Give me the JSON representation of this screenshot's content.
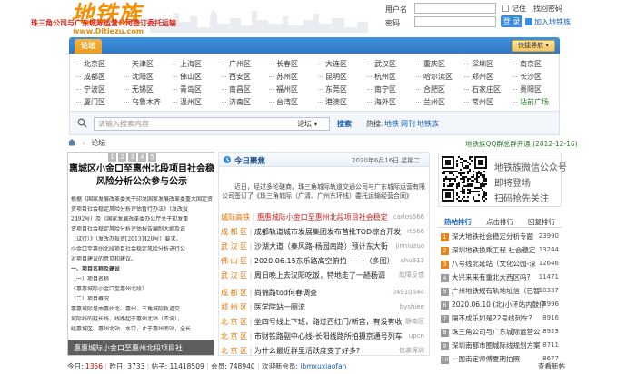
{
  "logo": {
    "title": "地铁族",
    "url": "www.Ditiezu.com"
  },
  "login": {
    "username_label": "用户名",
    "password_label": "密码",
    "remember_label": "记住",
    "forgot_label": "找回密码",
    "login_button": "登 录",
    "register_link": "加入地铁族"
  },
  "nav": {
    "forum_tab": "论坛",
    "quick_nav": "快捷导航"
  },
  "cities": [
    [
      "北京区",
      "天津区",
      "上海区",
      "广州区",
      "长春区",
      "大连区",
      "武汉区",
      "重庆区",
      "深圳区",
      "南京区"
    ],
    [
      "成都区",
      "沈阳区",
      "佛山区",
      "西安区",
      "苏州区",
      "昆明区",
      "杭州区",
      "哈尔滨区",
      "郑州区",
      "长沙区"
    ],
    [
      "宁波区",
      "无锡区",
      "青岛区",
      "南昌区",
      "福州区",
      "东莞区",
      "南宁区",
      "合肥区",
      "石家庄区",
      "贵阳区"
    ],
    [
      "厦门区",
      "乌鲁木齐",
      "温州区",
      "济南区",
      "台湾区",
      "港澳区",
      "海外区",
      "兰州区",
      "常州区",
      "站前广场"
    ]
  ],
  "city_colors": {
    "special": "#2c7a2c"
  },
  "search": {
    "placeholder": "请输入搜索内容",
    "scope": "论坛",
    "button": "搜索",
    "hot_label": "热搜:",
    "hot_terms": [
      "地铁",
      "网刊",
      "地铁族"
    ]
  },
  "breadcrumb": {
    "home_icon": "home-icon",
    "separator": "›",
    "current": "论坛"
  },
  "doc_preview": {
    "tabs": [
      "1",
      "2",
      "3",
      "4",
      "5"
    ],
    "title_lines": [
      "惠城区小金口至惠州北段项目社会稳",
      "风险分析公众参与公示"
    ],
    "body_lines": [
      "根据《国家发展改革委关于印发国家发展改革委重大固定资产",
      "资项目社会稳定风险分析评估暂行办法》（发改投",
      "2492号）及《国家发展改革委办公厅关于印发重",
      "资项目社会稳定风险分析评估报告编制大纲及说",
      "（试行）》（发改办投资[2013]428号）要求，",
      "小金口至惠州北段项目社会稳定风险分析进行公",
      "对项目建设的意见和建议。",
      "一、项目名称及建设",
      "（一）项目名称",
      "《惠惠城际小金口至惠州北段》",
      "（二）项目概况",
      "惠惠城际是由惠州北、惠州、三角城际轨道交",
      "城际线的延长线，线路起于惠州北站（不含），",
      "经惠城区、惠州北站、水口，止于惠州南站，全长"
    ],
    "caption": "惠惠城际小金口至惠州北段项目社"
  },
  "news": {
    "section_title": "今日聚焦",
    "date": "2020年6月16日 星期二",
    "headline": "珠三角公司与广东城际运营公司签订委托运输",
    "summary_lines": [
      "近日，经过多轮磋商，珠三角城际轨道交通公司与广东城际运营有限",
      "公司签订了《珠三角城际（广清、广州东环线）委托运输经营合同》及其"
    ],
    "items": [
      {
        "cat": "城际高铁",
        "title": "惠惠城际小金口至惠州北段项目社会稳定",
        "author": "carlos666",
        "red": true
      },
      {
        "cat": "成 都 区",
        "title": "成都轨道城市发展集团发布首批TOD综合开发",
        "author": "rt666",
        "red": false
      },
      {
        "cat": "武 汉 区",
        "title": "沙湖大道（秦风路-杨园南路）预计东大街",
        "author": "jinniuzuo",
        "red": false
      },
      {
        "cat": "佛 山 区",
        "title": "2020.06.15东乐路高空俯拍~~~（多图）",
        "author": "ahu813",
        "red": false
      },
      {
        "cat": "武 汉 区",
        "title": "周日晚上去汉阳吃饭，特地走了一趟杨泗",
        "author": "故障反馈",
        "red": false
      },
      {
        "cat": "成 都 区",
        "title": "尚锦路tod何春调查",
        "author": "04910644",
        "red": false
      },
      {
        "cat": "郑 州 区",
        "title": "医学院站一圈流",
        "author": "byshiee",
        "red": false
      },
      {
        "cat": "北 京 区",
        "title": "坐四号线上下班，路过西红门/新宫，有没有收",
        "author": "静南区",
        "red": false
      },
      {
        "cat": "北 京 区",
        "title": "市财铁路副中心线-长阳线路所拍摄京通号列车",
        "author": "upcn",
        "red": false
      },
      {
        "cat": "北 京 区",
        "title": "为什么最近群里活跃度变了好多?",
        "author": "包装深圳",
        "red": false
      }
    ]
  },
  "sidebar": {
    "qq_notice": "地铁族QQ群总群开通 (2012-12-16)",
    "wechat_lines": [
      "地铁族微信公众号",
      "即将登场",
      "扫码抢先关注"
    ],
    "rank_tabs": [
      "热帖排行",
      "点击排行",
      "回复排行"
    ],
    "rank_items": [
      {
        "rank": "1",
        "title": "深大地铁社会稳定分析专题",
        "value": "23990"
      },
      {
        "rank": "2",
        "title": "深圳地铁换乘工程 社会稳定",
        "value": "13244"
      },
      {
        "rank": "3",
        "title": "八号线北延站（文化公园-深",
        "value": "12646"
      },
      {
        "rank": "4",
        "title": "大兴来来有重北大西区吗?",
        "value": "11471"
      },
      {
        "rank": "5",
        "title": "广州地铁规有轨地址信（已暂",
        "value": "10337"
      },
      {
        "rank": "6",
        "title": "2020.06.10 (北)小环站内鼓停",
        "value": "8996"
      },
      {
        "rank": "7",
        "title": "隔不成乐如是22号线列车?",
        "value": "8916"
      },
      {
        "rank": "8",
        "title": "珠三角公司与广东城际运营公",
        "value": "8923"
      },
      {
        "rank": "9",
        "title": "深圳南都市圈城际线规划方案",
        "value": "8711"
      },
      {
        "rank": "10",
        "title": "一图南定师傅夏期拍照",
        "value": "8677"
      }
    ]
  },
  "footer": {
    "today_label": "今日:",
    "today": "1356",
    "yesterday_label": "昨日:",
    "yesterday": "3733",
    "posts_label": "帖子:",
    "posts": "11418509",
    "members_label": "会员:",
    "members": "748940",
    "newest_label": "欢迎新会员:",
    "newest": "ibmxuxiaofan",
    "more": "查看新帖"
  }
}
